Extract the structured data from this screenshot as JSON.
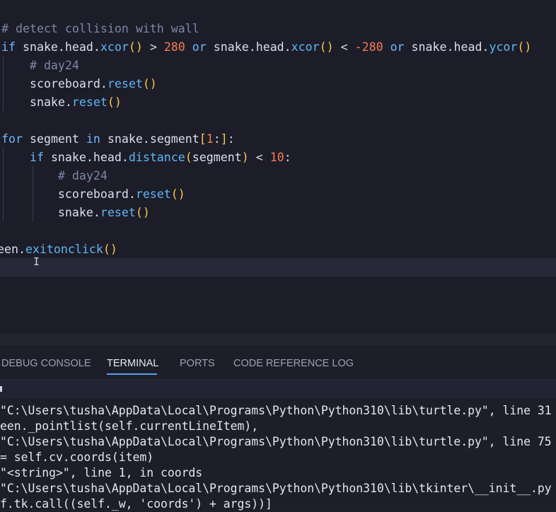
{
  "editor": {
    "lines": [
      {
        "tokens": [
          {
            "t": "# detect collision with wall",
            "c": "tok-comment"
          }
        ]
      },
      {
        "tokens": [
          {
            "t": "if",
            "c": "tok-kw"
          },
          {
            "t": " snake.head.",
            "c": "tok-ident"
          },
          {
            "t": "xcor",
            "c": "tok-fn"
          },
          {
            "t": "()",
            "c": "tok-bracket"
          },
          {
            "t": " > ",
            "c": "tok-op"
          },
          {
            "t": "280",
            "c": "tok-num"
          },
          {
            "t": " or",
            "c": "tok-kw"
          },
          {
            "t": " snake.head.",
            "c": "tok-ident"
          },
          {
            "t": "xcor",
            "c": "tok-fn"
          },
          {
            "t": "()",
            "c": "tok-bracket"
          },
          {
            "t": " < ",
            "c": "tok-op"
          },
          {
            "t": "-280",
            "c": "tok-num"
          },
          {
            "t": " or",
            "c": "tok-kw"
          },
          {
            "t": " snake.head.",
            "c": "tok-ident"
          },
          {
            "t": "ycor",
            "c": "tok-fn"
          },
          {
            "t": "()",
            "c": "tok-bracket"
          }
        ]
      },
      {
        "tokens": [
          {
            "t": "    # day24",
            "c": "tok-comment"
          }
        ]
      },
      {
        "tokens": [
          {
            "t": "    scoreboard.",
            "c": "tok-ident"
          },
          {
            "t": "reset",
            "c": "tok-fn"
          },
          {
            "t": "()",
            "c": "tok-bracket"
          }
        ]
      },
      {
        "tokens": [
          {
            "t": "    snake.",
            "c": "tok-ident"
          },
          {
            "t": "reset",
            "c": "tok-fn"
          },
          {
            "t": "()",
            "c": "tok-bracket"
          }
        ]
      },
      {
        "tokens": []
      },
      {
        "tokens": [
          {
            "t": "for",
            "c": "tok-kw"
          },
          {
            "t": " segment ",
            "c": "tok-ident"
          },
          {
            "t": "in",
            "c": "tok-kw"
          },
          {
            "t": " snake.segment",
            "c": "tok-ident"
          },
          {
            "t": "[",
            "c": "tok-bracket"
          },
          {
            "t": "1",
            "c": "tok-num"
          },
          {
            "t": ":",
            "c": "tok-op"
          },
          {
            "t": "]",
            "c": "tok-bracket"
          },
          {
            "t": ":",
            "c": "tok-op"
          }
        ]
      },
      {
        "tokens": [
          {
            "t": "    if",
            "c": "tok-kw"
          },
          {
            "t": " snake.head.",
            "c": "tok-ident"
          },
          {
            "t": "distance",
            "c": "tok-fn"
          },
          {
            "t": "(",
            "c": "tok-bracket"
          },
          {
            "t": "segment",
            "c": "tok-ident"
          },
          {
            "t": ")",
            "c": "tok-bracket"
          },
          {
            "t": " < ",
            "c": "tok-op"
          },
          {
            "t": "10",
            "c": "tok-num"
          },
          {
            "t": ":",
            "c": "tok-op"
          }
        ]
      },
      {
        "tokens": [
          {
            "t": "        # day24",
            "c": "tok-comment"
          }
        ]
      },
      {
        "tokens": [
          {
            "t": "        scoreboard.",
            "c": "tok-ident"
          },
          {
            "t": "reset",
            "c": "tok-fn"
          },
          {
            "t": "()",
            "c": "tok-bracket"
          }
        ]
      },
      {
        "tokens": [
          {
            "t": "        snake.",
            "c": "tok-ident"
          },
          {
            "t": "reset",
            "c": "tok-fn"
          },
          {
            "t": "()",
            "c": "tok-bracket"
          }
        ]
      },
      {
        "tokens": []
      },
      {
        "tokens": [
          {
            "t": "een.",
            "c": "tok-ident"
          },
          {
            "t": "exitonclick",
            "c": "tok-fn"
          },
          {
            "t": "()",
            "c": "tok-bracket"
          }
        ]
      },
      {
        "tokens": []
      }
    ],
    "cursor_glyph": "I"
  },
  "panel": {
    "tabs": [
      {
        "label": "DEBUG CONSOLE",
        "active": false
      },
      {
        "label": "TERMINAL",
        "active": true
      },
      {
        "label": "PORTS",
        "active": false
      },
      {
        "label": "CODE REFERENCE LOG",
        "active": false
      }
    ],
    "terminal_lines": [
      "\"C:\\Users\\tusha\\AppData\\Local\\Programs\\Python\\Python310\\lib\\turtle.py\", line 31",
      "een._pointlist(self.currentLineItem),",
      "\"C:\\Users\\tusha\\AppData\\Local\\Programs\\Python\\Python310\\lib\\turtle.py\", line 75",
      "= self.cv.coords(item)",
      "\"<string>\", line 1, in coords",
      "\"C:\\Users\\tusha\\AppData\\Local\\Programs\\Python\\Python310\\lib\\tkinter\\__init__.py",
      "f.tk.call((self._w, 'coords') + args))]"
    ]
  }
}
